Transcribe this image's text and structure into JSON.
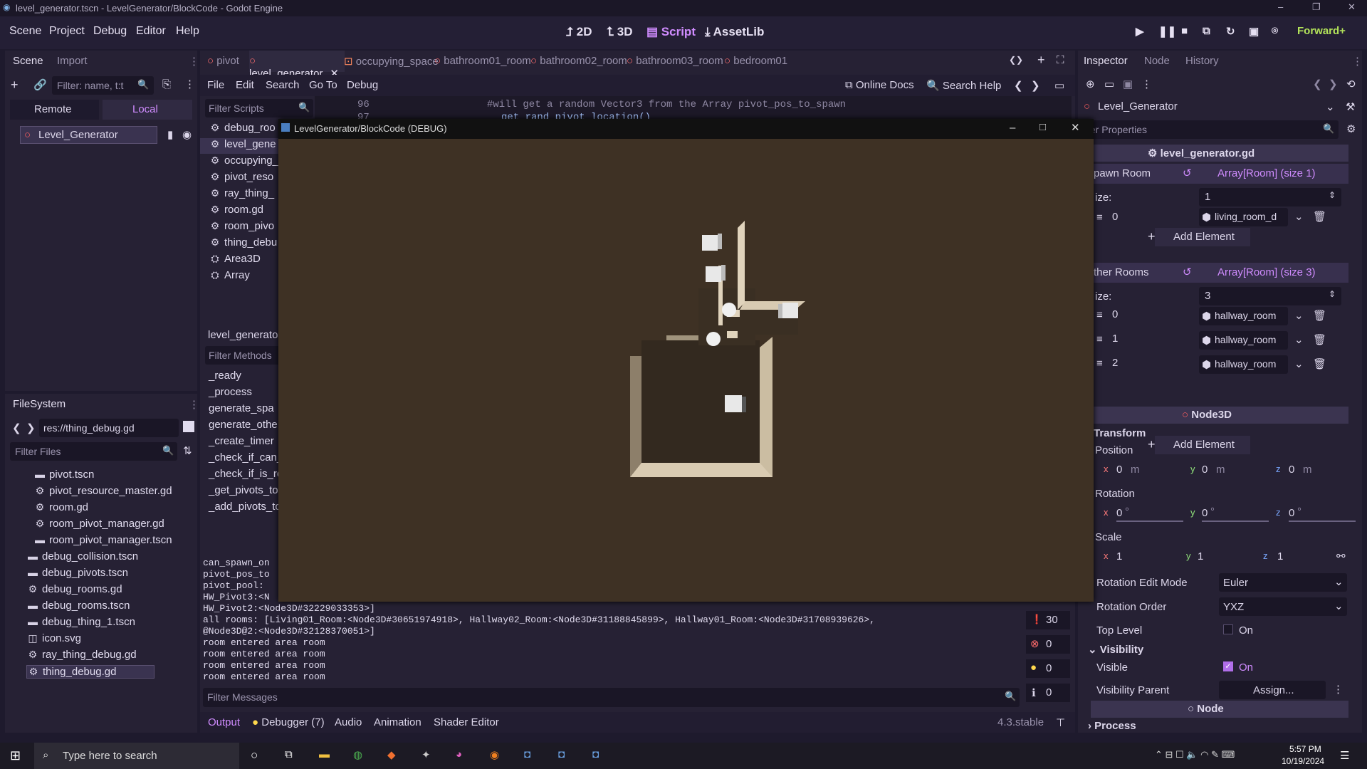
{
  "window_title": "level_generator.tscn - LevelGenerator/BlockCode - Godot Engine",
  "menus": [
    "Scene",
    "Project",
    "Debug",
    "Editor",
    "Help"
  ],
  "modes": {
    "d2": "2D",
    "d3": "3D",
    "script": "Script",
    "assetlib": "AssetLib"
  },
  "renderer": "Forward+",
  "scene_dock": {
    "tabs": [
      "Scene",
      "Import"
    ],
    "filter_placeholder": "Filter: name, t:t",
    "remote": "Remote",
    "local": "Local",
    "root_node": "Level_Generator"
  },
  "filesystem": {
    "tab": "FileSystem",
    "path": "res://thing_debug.gd",
    "filter_placeholder": "Filter Files",
    "items": [
      "pivot.tscn",
      "pivot_resource_master.gd",
      "room.gd",
      "room_pivot_manager.gd",
      "room_pivot_manager.tscn",
      "debug_collision.tscn",
      "debug_pivots.tscn",
      "debug_rooms.gd",
      "debug_rooms.tscn",
      "debug_thing_1.tscn",
      "icon.svg",
      "ray_thing_debug.gd",
      "thing_debug.gd"
    ]
  },
  "editor_tabs": [
    "pivot",
    "level_generator",
    "occupying_space",
    "bathroom01_room",
    "bathroom02_room",
    "bathroom03_room",
    "bedroom01"
  ],
  "script_menu": [
    "File",
    "Edit",
    "Search",
    "Go To",
    "Debug"
  ],
  "online_docs": "Online Docs",
  "search_help": "Search Help",
  "filter_scripts": "Filter Scripts",
  "scripts": [
    "debug_roo",
    "level_gene",
    "occupying_",
    "pivot_reso",
    "ray_thing_",
    "room.gd",
    "room_pivo",
    "thing_debu",
    "Area3D",
    "Array"
  ],
  "current_script": "level_generator",
  "filter_methods": "Filter Methods",
  "methods": [
    "_ready",
    "_process",
    "generate_spa",
    "generate_othe",
    "_create_timer",
    "_check_if_can_",
    "_check_if_is_ro",
    "_get_pivots_to",
    "_add_pivots_to"
  ],
  "code": {
    "line1_no": "96",
    "line1": "#will get a random Vector3 from the Array pivot_pos_to_spawn",
    "line2_no": "97",
    "line2": "get_rand_pivot_location()"
  },
  "output_lines": [
    "can_spawn_on",
    "pivot_pos_to",
    "pivot_pool:",
    "HW_Pivot3:<N",
    "HW_Pivot2:<Node3D#32229033353>]",
    "all rooms: [Living01_Room:<Node3D#30651974918>, Hallway02_Room:<Node3D#31188845899>, Hallway01_Room:<Node3D#31708939626>,",
    "@Node3D@2:<Node3D#32128370051>]",
    "room entered area room",
    "room entered area room",
    "room entered area room",
    "room entered area room"
  ],
  "filter_messages": "Filter Messages",
  "counts": {
    "msgs": "30",
    "errors": "0",
    "warnings": "0",
    "info": "0"
  },
  "bottom_tabs": [
    "Output",
    "Debugger (7)",
    "Audio",
    "Animation",
    "Shader Editor"
  ],
  "version": "4.3.stable",
  "game_window_title": "LevelGenerator/BlockCode (DEBUG)",
  "inspector": {
    "tabs": [
      "Inspector",
      "Node",
      "History"
    ],
    "node": "Level_Generator",
    "filter_placeholder": "ter Properties",
    "script": "level_generator.gd",
    "spawn_room": "pawn Room",
    "spawn_room_type": "Array[Room] (size 1)",
    "size_label": "ize:",
    "spawn_size": "1",
    "spawn_items": [
      {
        "idx": "0",
        "val": "living_room_d"
      }
    ],
    "add_element": "Add Element",
    "other_rooms": "ther Rooms",
    "other_rooms_type": "Array[Room] (size 3)",
    "other_size": "3",
    "other_items": [
      {
        "idx": "0",
        "val": "hallway_room"
      },
      {
        "idx": "1",
        "val": "hallway_room"
      },
      {
        "idx": "2",
        "val": "hallway_room"
      }
    ],
    "node3d": "Node3D",
    "transform": "Transform",
    "position": "Position",
    "rotation": "Rotation",
    "scale": "Scale",
    "pos": {
      "x": "0",
      "y": "0",
      "z": "0",
      "unit": "m"
    },
    "rot": {
      "x": "0",
      "y": "0",
      "z": "0",
      "unit": "°"
    },
    "scl": {
      "x": "1",
      "y": "1",
      "z": "1"
    },
    "rotation_edit_mode": "Rotation Edit Mode",
    "rotation_edit_value": "Euler",
    "rotation_order": "Rotation Order",
    "rotation_order_value": "YXZ",
    "top_level": "Top Level",
    "on": "On",
    "visibility": "Visibility",
    "visible": "Visible",
    "visibility_parent": "Visibility Parent",
    "assign": "Assign...",
    "node_section": "Node",
    "process": "Process"
  },
  "taskbar": {
    "search": "Type here to search",
    "time": "5:57 PM",
    "date": "10/19/2024"
  }
}
